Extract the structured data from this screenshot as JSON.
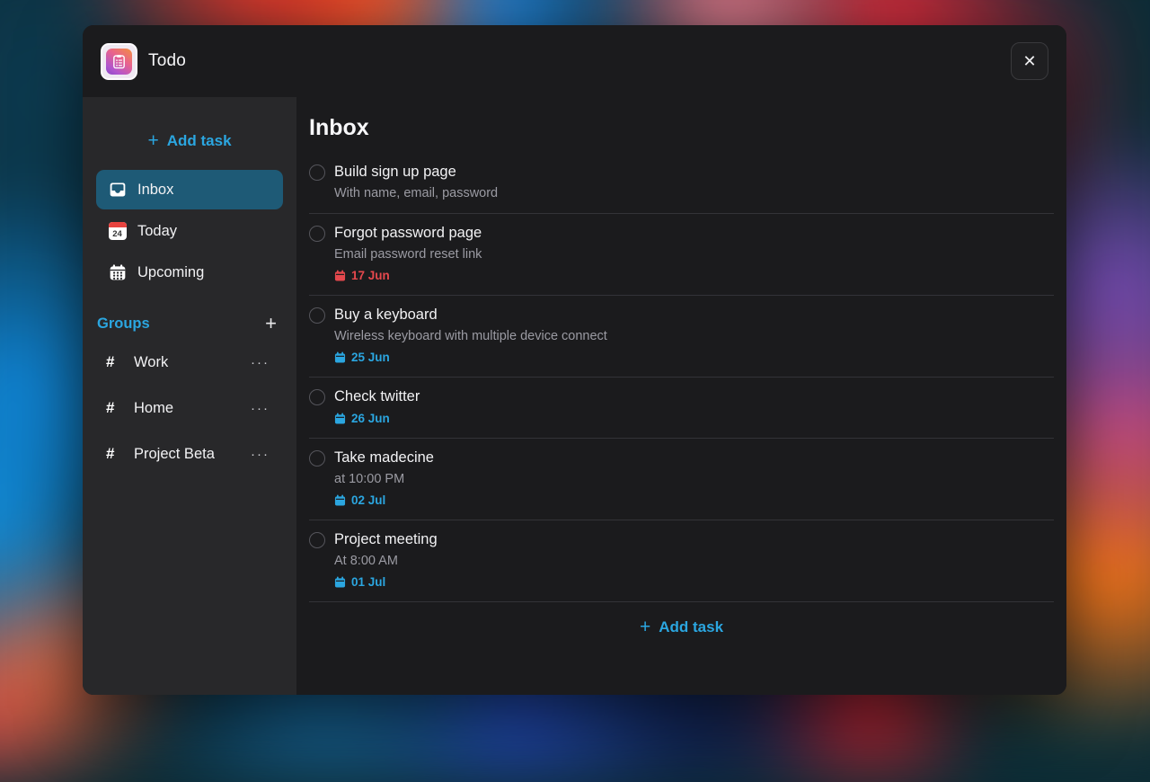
{
  "app": {
    "title": "Todo"
  },
  "icons": {
    "plus": "+",
    "ellipsis": "···",
    "close": "✕"
  },
  "colors": {
    "accent": "#2ba6e0",
    "overdue": "#e5484d",
    "selected_bg": "#1e5a76"
  },
  "sidebar": {
    "add_task_label": "Add task",
    "items": [
      {
        "label": "Inbox",
        "selected": true
      },
      {
        "label": "Today",
        "badge": "24",
        "selected": false
      },
      {
        "label": "Upcoming",
        "selected": false
      }
    ],
    "groups": {
      "label": "Groups",
      "items": [
        {
          "label": "Work"
        },
        {
          "label": "Home"
        },
        {
          "label": "Project Beta"
        }
      ]
    }
  },
  "main": {
    "title": "Inbox",
    "add_task_label": "Add task",
    "tasks": [
      {
        "title": "Build sign up page",
        "subtitle": "With name, email, password",
        "date": null,
        "overdue": false
      },
      {
        "title": "Forgot password page",
        "subtitle": "Email password reset link",
        "date": "17 Jun",
        "overdue": true
      },
      {
        "title": "Buy a keyboard",
        "subtitle": "Wireless keyboard with multiple device connect",
        "date": "25 Jun",
        "overdue": false
      },
      {
        "title": "Check twitter",
        "subtitle": null,
        "date": "26 Jun",
        "overdue": false
      },
      {
        "title": "Take madecine",
        "subtitle": "at 10:00 PM",
        "date": "02 Jul",
        "overdue": false
      },
      {
        "title": "Project meeting",
        "subtitle": "At 8:00 AM",
        "date": "01 Jul",
        "overdue": false
      }
    ]
  }
}
